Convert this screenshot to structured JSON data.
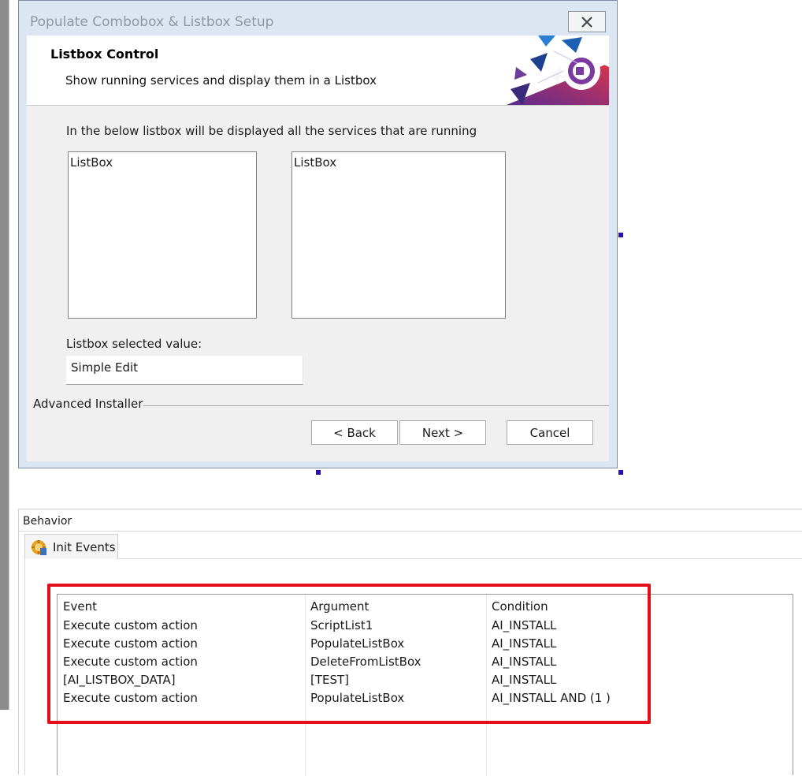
{
  "dialog": {
    "title": "Populate Combobox & Listbox Setup",
    "heading": "Listbox Control",
    "subheading": "Show running services and display them in a Listbox",
    "description": "In the below listbox will be displayed all the services that are running",
    "listbox1_label": "ListBox",
    "listbox2_label": "ListBox",
    "selected_label": "Listbox selected value:",
    "edit_value": "Simple Edit",
    "brand": "Advanced Installer",
    "buttons": {
      "back": "< Back",
      "next": "Next >",
      "cancel": "Cancel"
    }
  },
  "behavior": {
    "panel_label": "Behavior",
    "tab": "Init Events",
    "table": {
      "headers": [
        "Event",
        "Argument",
        "Condition"
      ],
      "rows": [
        [
          "Execute custom action",
          "ScriptList1",
          "AI_INSTALL"
        ],
        [
          "Execute custom action",
          "PopulateListBox",
          "AI_INSTALL"
        ],
        [
          "Execute custom action",
          "DeleteFromListBox",
          "AI_INSTALL"
        ],
        [
          "[AI_LISTBOX_DATA]",
          "[TEST]",
          "AI_INSTALL"
        ],
        [
          "Execute custom action",
          "PopulateListBox",
          "AI_INSTALL AND (1 )"
        ]
      ]
    }
  },
  "colors": {
    "highlight": "#e3101c",
    "handle": "#2b0fb0",
    "dialog_frame": "#dce6f2"
  },
  "icons": [
    "close-icon",
    "banner-logo-icon",
    "init-events-icon"
  ]
}
